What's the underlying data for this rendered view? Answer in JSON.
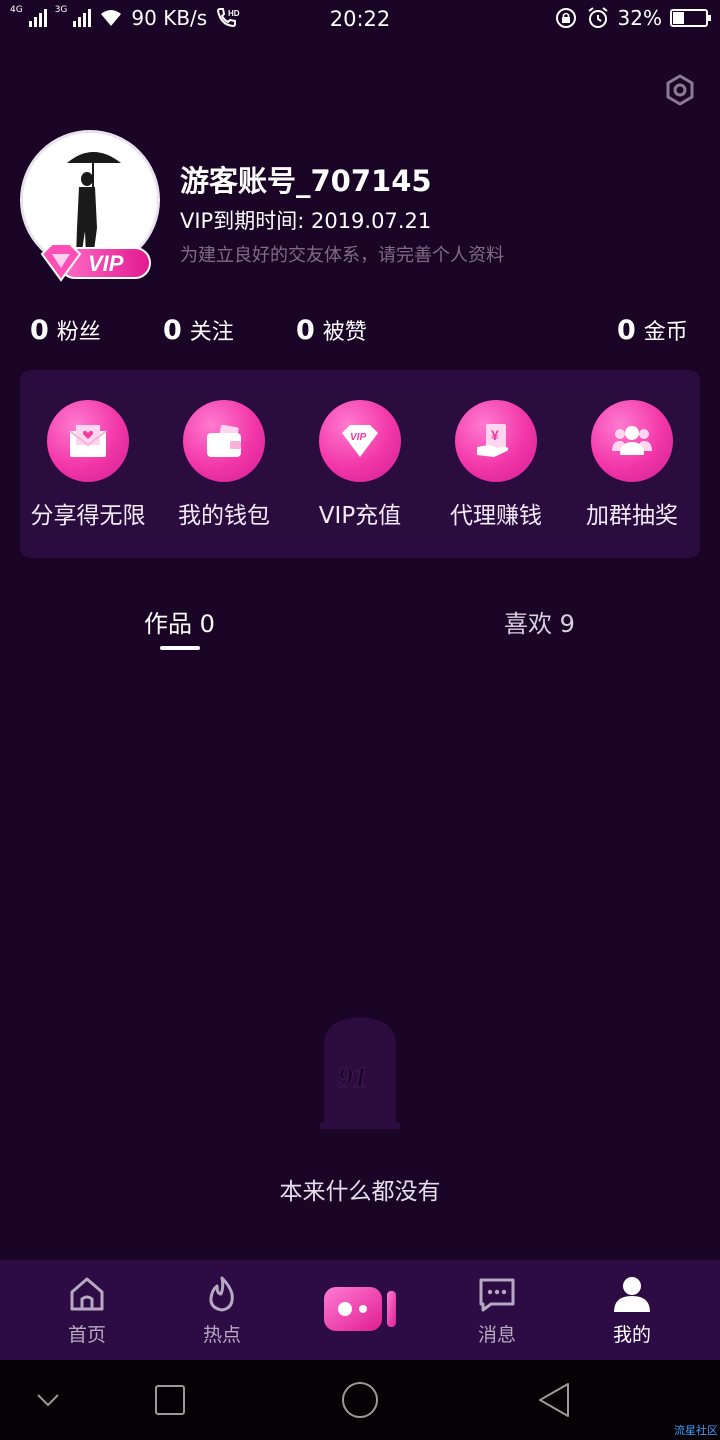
{
  "status_bar": {
    "net1": "4G",
    "net2": "3G",
    "speed": "90 KB/s",
    "hd": "HD",
    "time": "20:22",
    "battery_percent": "32%",
    "battery_level": 0.32
  },
  "profile": {
    "username": "游客账号_707145",
    "vip_expire": "VIP到期时间: 2019.07.21",
    "tip": "为建立良好的交友体系，请完善个人资料",
    "vip_badge": "VIP"
  },
  "stats": [
    {
      "num": "0",
      "label": "粉丝"
    },
    {
      "num": "0",
      "label": "关注"
    },
    {
      "num": "0",
      "label": "被赞"
    },
    {
      "num": "0",
      "label": "金币"
    }
  ],
  "features": [
    {
      "label": "分享得无限",
      "icon": "envelope-heart-icon"
    },
    {
      "label": "我的钱包",
      "icon": "wallet-icon"
    },
    {
      "label": "VIP充值",
      "icon": "vip-diamond-icon"
    },
    {
      "label": "代理赚钱",
      "icon": "money-hand-icon"
    },
    {
      "label": "加群抽奖",
      "icon": "group-icon"
    }
  ],
  "tabs": [
    {
      "label": "作品 0",
      "active": true
    },
    {
      "label": "喜欢 9",
      "active": false
    }
  ],
  "empty": {
    "text": "本来什么都没有",
    "logo_text": "91"
  },
  "bottom_nav": [
    {
      "label": "首页",
      "icon": "home-icon"
    },
    {
      "label": "热点",
      "icon": "flame-icon"
    },
    {
      "label": "",
      "icon": "camera-icon"
    },
    {
      "label": "消息",
      "icon": "message-icon"
    },
    {
      "label": "我的",
      "icon": "user-icon",
      "active": true
    }
  ],
  "watermark": "流星社区",
  "colors": {
    "background": "#1a0526",
    "accent_pink": "#f236a8",
    "card": "#2a0c3e",
    "nav_bg": "#2d0b44"
  }
}
